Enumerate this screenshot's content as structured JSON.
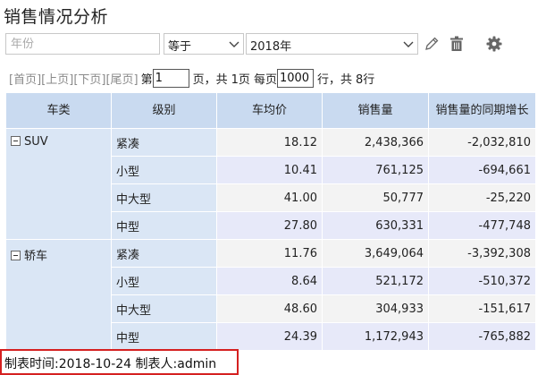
{
  "page": {
    "title": "销售情况分析"
  },
  "filter": {
    "field_placeholder": "年份",
    "operator": "等于",
    "value": "2018年"
  },
  "icons": {
    "edit": "pencil-icon",
    "delete": "trash-icon",
    "settings": "gear-icon"
  },
  "pager": {
    "first": "[首页]",
    "prev": "[上页]",
    "next": "[下页]",
    "last": "[尾页]",
    "page_prefix": "第",
    "current_page": "1",
    "page_suffix": "页，共",
    "total_pages": "1页",
    "size_prefix": "每页",
    "page_size": "1000",
    "size_suffix": "行，共",
    "total_rows": "8行"
  },
  "table": {
    "headers": [
      "车类",
      "级别",
      "车均价",
      "销售量",
      "销售量的同期增长"
    ],
    "groups": [
      {
        "category": "SUV",
        "rows": [
          {
            "level": "紧凑",
            "avg_price": "18.12",
            "sales": "2,438,366",
            "yoy": "-2,032,810"
          },
          {
            "level": "小型",
            "avg_price": "10.41",
            "sales": "761,125",
            "yoy": "-694,661"
          },
          {
            "level": "中大型",
            "avg_price": "41.00",
            "sales": "50,777",
            "yoy": "-25,220"
          },
          {
            "level": "中型",
            "avg_price": "27.80",
            "sales": "630,331",
            "yoy": "-477,748"
          }
        ]
      },
      {
        "category": "轿车",
        "rows": [
          {
            "level": "紧凑",
            "avg_price": "11.76",
            "sales": "3,649,064",
            "yoy": "-3,392,308"
          },
          {
            "level": "小型",
            "avg_price": "8.64",
            "sales": "521,172",
            "yoy": "-510,372"
          },
          {
            "level": "中大型",
            "avg_price": "48.60",
            "sales": "304,933",
            "yoy": "-151,617"
          },
          {
            "level": "中型",
            "avg_price": "24.39",
            "sales": "1,172,943",
            "yoy": "-765,882"
          }
        ]
      }
    ]
  },
  "footer": {
    "text": "制表时间:2018-10-24   制表人:admin"
  },
  "colors": {
    "header_bg": "#c9daf0",
    "highlight_border": "#d52020"
  }
}
